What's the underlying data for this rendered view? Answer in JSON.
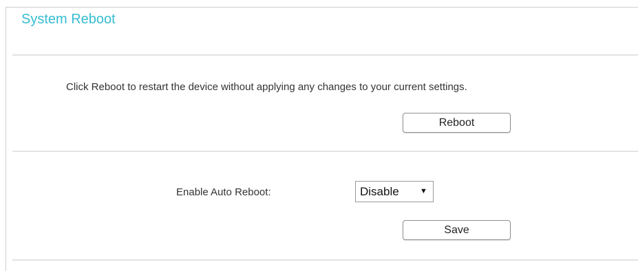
{
  "page": {
    "title": "System Reboot"
  },
  "reboot_section": {
    "description": "Click Reboot to restart the device without applying any changes to your current settings.",
    "button_label": "Reboot"
  },
  "auto_reboot_section": {
    "label": "Enable Auto Reboot:",
    "select": {
      "selected": "Disable",
      "arrow_icon": "▼"
    },
    "save_label": "Save"
  },
  "colors": {
    "title_accent": "#35bdd2",
    "divider": "#e3e3e3"
  }
}
